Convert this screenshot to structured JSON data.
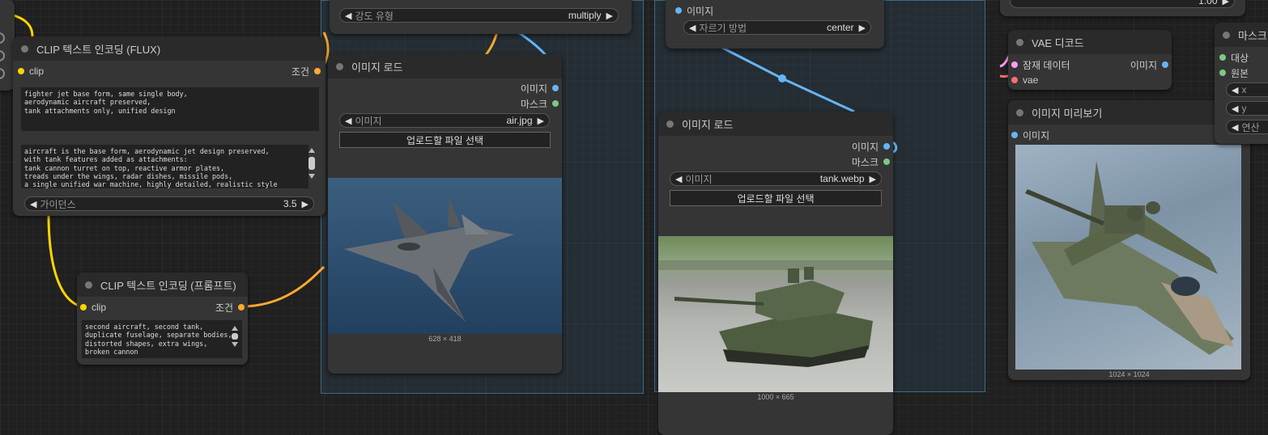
{
  "colors": {
    "clip": "#ffd500",
    "conditioning": "#ffa931",
    "image": "#64b5f6",
    "mask": "#81c784",
    "latent": "#ff9cf9",
    "vae": "#ff6e6e"
  },
  "clip_flux": {
    "title": "CLIP 텍스트 인코딩 (FLUX)",
    "input_clip": "clip",
    "output": "조건",
    "text1": "fighter jet base form, same single body,\naerodynamic aircraft preserved,\ntank attachments only, unified design",
    "text2": "aircraft is the base form, aerodynamic jet design preserved,\nwith tank features added as attachments:\ntank cannon turret on top, reactive armor plates,\ntreads under the wings, radar dishes, missile pods,\na single unified war machine, highly detailed, realistic style",
    "guidance_label": "가이던스",
    "guidance_value": "3.5"
  },
  "clip_prompt": {
    "title": "CLIP 텍스트 인코딩 (프롬프트)",
    "input_clip": "clip",
    "output": "조건",
    "text": "second aircraft, second tank,\nduplicate fuselage, separate bodies,\ndistorted shapes, extra wings,\nbroken cannon"
  },
  "top_node": {
    "widget_label": "강도 유형",
    "widget_value": "multiply"
  },
  "load_air": {
    "title": "이미지 로드",
    "out_image": "이미지",
    "out_mask": "마스크",
    "image_label": "이미지",
    "image_value": "air.jpg",
    "upload": "업로드할 파일 선택",
    "dims": "628 × 418"
  },
  "crop_node": {
    "input": "이미지",
    "crop_label": "자르기 방법",
    "crop_value": "center"
  },
  "load_tank": {
    "title": "이미지 로드",
    "out_image": "이미지",
    "out_mask": "마스크",
    "image_label": "이미지",
    "image_value": "tank.webp",
    "upload": "업로드할 파일 선택",
    "dims": "1000 × 665"
  },
  "top_right": {
    "value": "1.00"
  },
  "vae_decode": {
    "title": "VAE 디코드",
    "in_latent": "잠재 데이터",
    "in_vae": "vae",
    "output": "이미지"
  },
  "preview": {
    "title": "이미지 미리보기",
    "input": "이미지",
    "dims": "1024 × 1024"
  },
  "mask_node": {
    "title": "마스크",
    "in_target": "대상",
    "in_source": "원본",
    "x_label": "x",
    "y_label": "y",
    "op_label": "연산"
  }
}
